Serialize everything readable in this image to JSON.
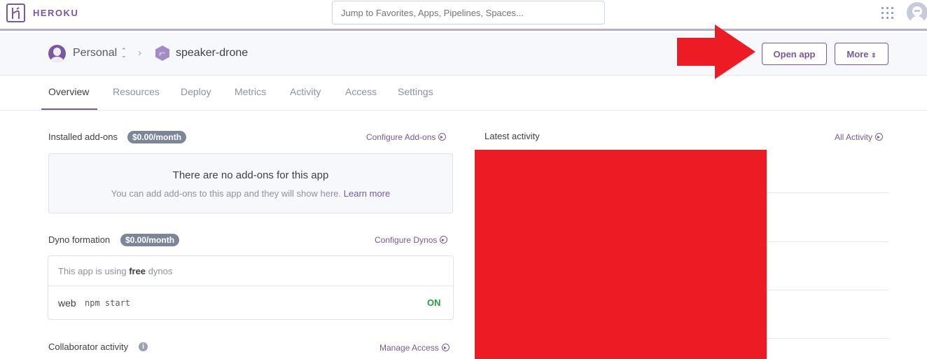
{
  "brand": {
    "name": "HEROKU",
    "primary": "#79589f",
    "redaction": "#ed1c24"
  },
  "search": {
    "placeholder": "Jump to Favorites, Apps, Pipelines, Spaces..."
  },
  "breadcrumb": {
    "account": "Personal",
    "app": "speaker-drone"
  },
  "actions": {
    "open_app": "Open app",
    "more": "More"
  },
  "tabs": [
    "Overview",
    "Resources",
    "Deploy",
    "Metrics",
    "Activity",
    "Access",
    "Settings"
  ],
  "addons": {
    "title": "Installed add-ons",
    "price": "$0.00/month",
    "configure": "Configure Add-ons",
    "empty_title": "There are no add-ons for this app",
    "empty_sub": "You can add add-ons to this app and they will show here.",
    "learn_more": "Learn more"
  },
  "dynos": {
    "title": "Dyno formation",
    "price": "$0.00/month",
    "configure": "Configure Dynos",
    "note_prefix": "This app is using",
    "note_bold": "free",
    "note_suffix": "dynos",
    "process": {
      "type": "web",
      "command": "npm start",
      "status": "ON"
    }
  },
  "collaborators": {
    "title": "Collaborator activity",
    "manage": "Manage Access"
  },
  "activity": {
    "title": "Latest activity",
    "all": "All Activity"
  }
}
